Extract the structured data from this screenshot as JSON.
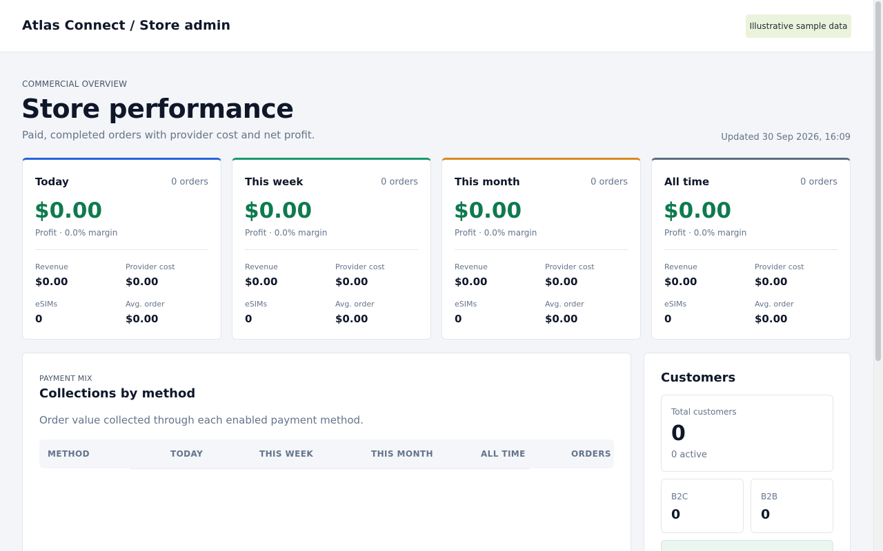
{
  "header": {
    "brand": "Atlas Connect / Store admin",
    "badge": "Illustrative sample data"
  },
  "page": {
    "eyebrow": "COMMERCIAL OVERVIEW",
    "title": "Store performance",
    "subtitle": "Paid, completed orders with provider cost and net profit.",
    "updated": "Updated 30 Sep 2026, 16:09"
  },
  "colors": {
    "today": "#2563d9",
    "week": "#169a6a",
    "month": "#d9891e",
    "all_time": "#5b6b80",
    "profit": "#0f7a4f"
  },
  "kpis": [
    {
      "title": "Today",
      "orders": "0 orders",
      "profit": "$0.00",
      "margin": "Profit · 0.0% margin",
      "revenue_label": "Revenue",
      "revenue": "$0.00",
      "cost_label": "Provider cost",
      "cost": "$0.00",
      "esims_label": "eSIMs",
      "esims": "0",
      "avg_label": "Avg. order",
      "avg": "$0.00"
    },
    {
      "title": "This week",
      "orders": "0 orders",
      "profit": "$0.00",
      "margin": "Profit · 0.0% margin",
      "revenue_label": "Revenue",
      "revenue": "$0.00",
      "cost_label": "Provider cost",
      "cost": "$0.00",
      "esims_label": "eSIMs",
      "esims": "0",
      "avg_label": "Avg. order",
      "avg": "$0.00"
    },
    {
      "title": "This month",
      "orders": "0 orders",
      "profit": "$0.00",
      "margin": "Profit · 0.0% margin",
      "revenue_label": "Revenue",
      "revenue": "$0.00",
      "cost_label": "Provider cost",
      "cost": "$0.00",
      "esims_label": "eSIMs",
      "esims": "0",
      "avg_label": "Avg. order",
      "avg": "$0.00"
    },
    {
      "title": "All time",
      "orders": "0 orders",
      "profit": "$0.00",
      "margin": "Profit · 0.0% margin",
      "revenue_label": "Revenue",
      "revenue": "$0.00",
      "cost_label": "Provider cost",
      "cost": "$0.00",
      "esims_label": "eSIMs",
      "esims": "0",
      "avg_label": "Avg. order",
      "avg": "$0.00"
    }
  ],
  "payment_mix": {
    "eyebrow": "PAYMENT MIX",
    "title": "Collections by method",
    "description": "Order value collected through each enabled payment method.",
    "columns": [
      "METHOD",
      "TODAY",
      "THIS WEEK",
      "THIS MONTH",
      "ALL TIME",
      "ORDERS"
    ]
  },
  "customers": {
    "title": "Customers",
    "total_label": "Total customers",
    "total": "0",
    "active": "0 active",
    "b2c_label": "B2C",
    "b2c": "0",
    "b2b_label": "B2B",
    "b2b": "0"
  }
}
